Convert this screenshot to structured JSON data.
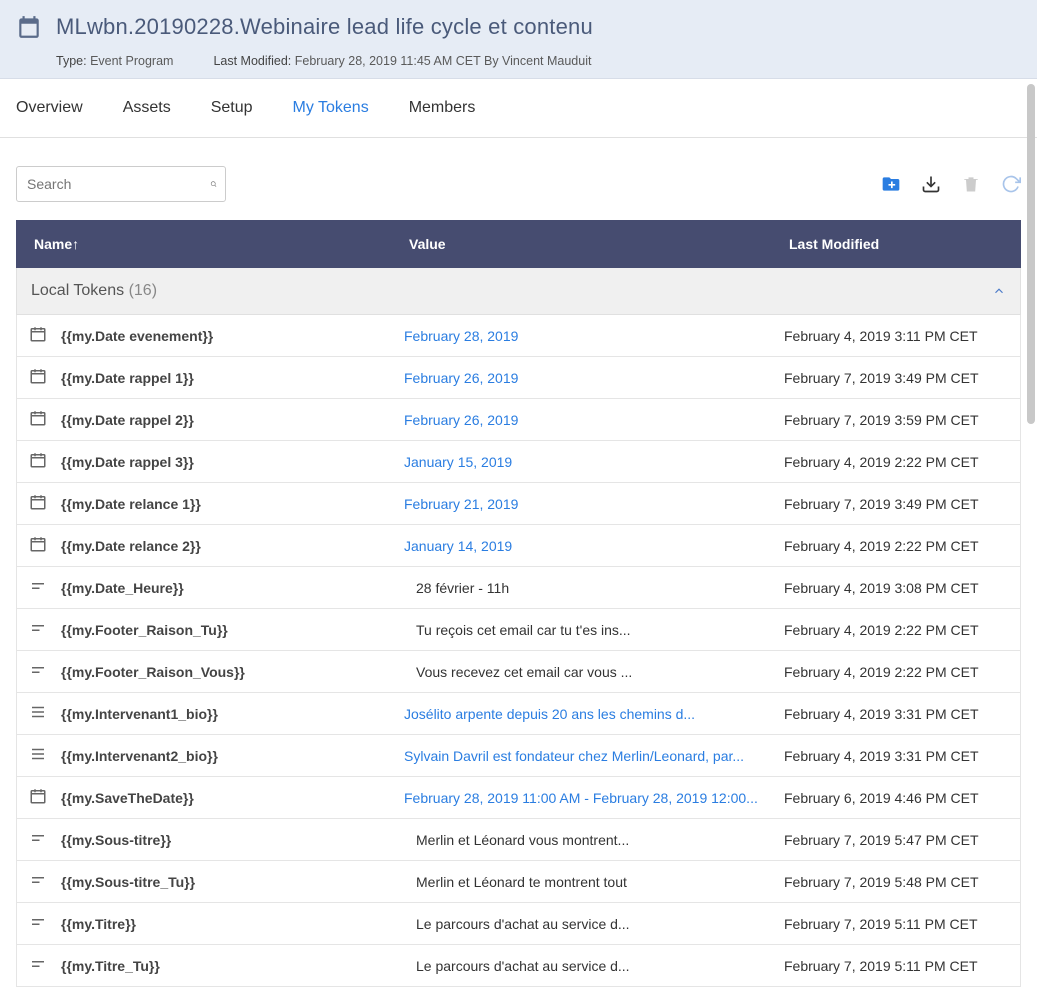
{
  "header": {
    "title": "MLwbn.20190228.Webinaire lead life cycle et contenu",
    "type_label": "Type:",
    "type_value": "Event Program",
    "modified_label": "Last Modified:",
    "modified_value": "February 28, 2019 11:45 AM CET By Vincent Mauduit"
  },
  "tabs": [
    "Overview",
    "Assets",
    "Setup",
    "My Tokens",
    "Members"
  ],
  "active_tab": "My Tokens",
  "search_placeholder": "Search",
  "columns": {
    "name": "Name↑",
    "value": "Value",
    "modified": "Last Modified"
  },
  "group": {
    "label": "Local Tokens",
    "count": "(16)"
  },
  "rows": [
    {
      "icon": "cal",
      "name": "{{my.Date evenement}}",
      "value": "February 28, 2019",
      "link": true,
      "modified": "February 4, 2019 3:11 PM CET"
    },
    {
      "icon": "cal",
      "name": "{{my.Date rappel 1}}",
      "value": "February 26, 2019",
      "link": true,
      "modified": "February 7, 2019 3:49 PM CET"
    },
    {
      "icon": "cal",
      "name": "{{my.Date rappel 2}}",
      "value": "February 26, 2019",
      "link": true,
      "modified": "February 7, 2019 3:59 PM CET"
    },
    {
      "icon": "cal",
      "name": "{{my.Date rappel 3}}",
      "value": "January 15, 2019",
      "link": true,
      "modified": "February 4, 2019 2:22 PM CET"
    },
    {
      "icon": "cal",
      "name": "{{my.Date relance 1}}",
      "value": "February 21, 2019",
      "link": true,
      "modified": "February 7, 2019 3:49 PM CET"
    },
    {
      "icon": "cal",
      "name": "{{my.Date relance 2}}",
      "value": "January 14, 2019",
      "link": true,
      "modified": "February 4, 2019 2:22 PM CET"
    },
    {
      "icon": "text",
      "name": "{{my.Date_Heure}}",
      "value": "28 février - 11h",
      "link": false,
      "modified": "February 4, 2019 3:08 PM CET"
    },
    {
      "icon": "text",
      "name": "{{my.Footer_Raison_Tu}}",
      "value": "Tu reçois cet email car tu t'es ins...",
      "link": false,
      "modified": "February 4, 2019 2:22 PM CET"
    },
    {
      "icon": "text",
      "name": "{{my.Footer_Raison_Vous}}",
      "value": "Vous recevez cet email car vous ...",
      "link": false,
      "modified": "February 4, 2019 2:22 PM CET"
    },
    {
      "icon": "rich",
      "name": "{{my.Intervenant1_bio}}",
      "value": "Jos&eacute;lito arpente depuis 20 ans les chemins d...",
      "link": true,
      "modified": "February 4, 2019 3:31 PM CET"
    },
    {
      "icon": "rich",
      "name": "{{my.Intervenant2_bio}}",
      "value": "Sylvain Davril est fondateur chez Merlin/Leonard, par...",
      "link": true,
      "modified": "February 4, 2019 3:31 PM CET"
    },
    {
      "icon": "cal",
      "name": "{{my.SaveTheDate}}",
      "value": "February 28, 2019 11:00 AM - February 28, 2019 12:00...",
      "link": true,
      "modified": "February 6, 2019 4:46 PM CET"
    },
    {
      "icon": "text",
      "name": "{{my.Sous-titre}}",
      "value": "Merlin et Léonard vous montrent...",
      "link": false,
      "modified": "February 7, 2019 5:47 PM CET"
    },
    {
      "icon": "text",
      "name": "{{my.Sous-titre_Tu}}",
      "value": "Merlin et Léonard te montrent tout",
      "link": false,
      "modified": "February 7, 2019 5:48 PM CET"
    },
    {
      "icon": "text",
      "name": "{{my.Titre}}",
      "value": "Le parcours d'achat au service d...",
      "link": false,
      "modified": "February 7, 2019 5:11 PM CET"
    },
    {
      "icon": "text",
      "name": "{{my.Titre_Tu}}",
      "value": "Le parcours d'achat au service d...",
      "link": false,
      "modified": "February 7, 2019 5:11 PM CET"
    }
  ]
}
